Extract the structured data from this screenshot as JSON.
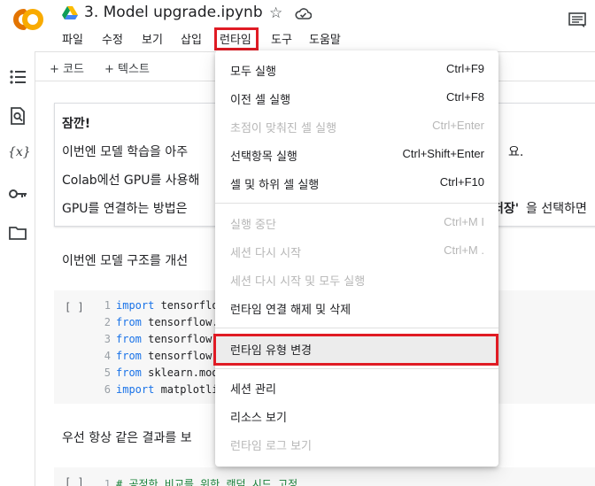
{
  "header": {
    "title": "3. Model upgrade.ipynb",
    "logo_text": "CO",
    "menus": [
      "파일",
      "수정",
      "보기",
      "삽입",
      "런타임",
      "도구",
      "도움말"
    ]
  },
  "toolbar": {
    "add_code": "+ 코드",
    "add_text": "+ 텍스트"
  },
  "sidebar": {
    "icons": [
      "toc-icon",
      "find-icon",
      "variables-icon",
      "secrets-key-icon",
      "files-icon"
    ],
    "variables_glyph": "{x}"
  },
  "notice": {
    "title": "잠깐!",
    "line1": "이번엔 모델 학습을 아주",
    "line1_tail": "요.",
    "line2": "Colab에선 GPU를 사용해",
    "line3": "GPU를 연결하는 방법은 ",
    "line3_bold": "저장'",
    "line3_tail": "을 선택하면"
  },
  "cells": {
    "text1": "이번엔 모델 구조를 개선",
    "code1_bracket": "[ ]",
    "code1": [
      {
        "n": "1",
        "kw": "import",
        "rest": " tensorflow"
      },
      {
        "n": "2",
        "kw": "from",
        "rest": " tensorflow.k"
      },
      {
        "n": "3",
        "kw": "from",
        "rest": " tensorflow.k"
      },
      {
        "n": "4",
        "kw": "from",
        "rest": " tensorflow.k"
      },
      {
        "n": "5",
        "kw": "from",
        "rest": " sklearn.mode"
      },
      {
        "n": "6",
        "kw": "import",
        "rest": " matplotlib"
      }
    ],
    "text2": "우선 항상 같은 결과를 보",
    "code2_bracket": "[ ]",
    "code2_line": {
      "n": "1",
      "comment": "# 공정한 비교를 위한 랜덤 시드 고정"
    }
  },
  "dropdown": {
    "items": [
      {
        "label": "모두 실행",
        "shortcut": "Ctrl+F9",
        "disabled": false
      },
      {
        "label": "이전 셀 실행",
        "shortcut": "Ctrl+F8",
        "disabled": false
      },
      {
        "label": "초점이 맞춰진 셀 실행",
        "shortcut": "Ctrl+Enter",
        "disabled": true
      },
      {
        "label": "선택항목 실행",
        "shortcut": "Ctrl+Shift+Enter",
        "disabled": false
      },
      {
        "label": "셀 및 하위 셀 실행",
        "shortcut": "Ctrl+F10",
        "disabled": false
      },
      {
        "label": "실행 중단",
        "shortcut": "Ctrl+M I",
        "disabled": true
      },
      {
        "label": "세션 다시 시작",
        "shortcut": "Ctrl+M .",
        "disabled": true
      },
      {
        "label": "세션 다시 시작 및 모두 실행",
        "shortcut": "",
        "disabled": true
      },
      {
        "label": "런타임 연결 해제 및 삭제",
        "shortcut": "",
        "disabled": false
      },
      {
        "label": "런타임 유형 변경",
        "shortcut": "",
        "disabled": false
      },
      {
        "label": "세션 관리",
        "shortcut": "",
        "disabled": false
      },
      {
        "label": "리소스 보기",
        "shortcut": "",
        "disabled": false
      },
      {
        "label": "런타임 로그 보기",
        "shortcut": "",
        "disabled": true
      }
    ]
  },
  "colors": {
    "highlight_box": "#e01b24",
    "logo_orange": "#f9ab00",
    "logo_dark": "#e37400",
    "keyword": "#1a73e8"
  }
}
